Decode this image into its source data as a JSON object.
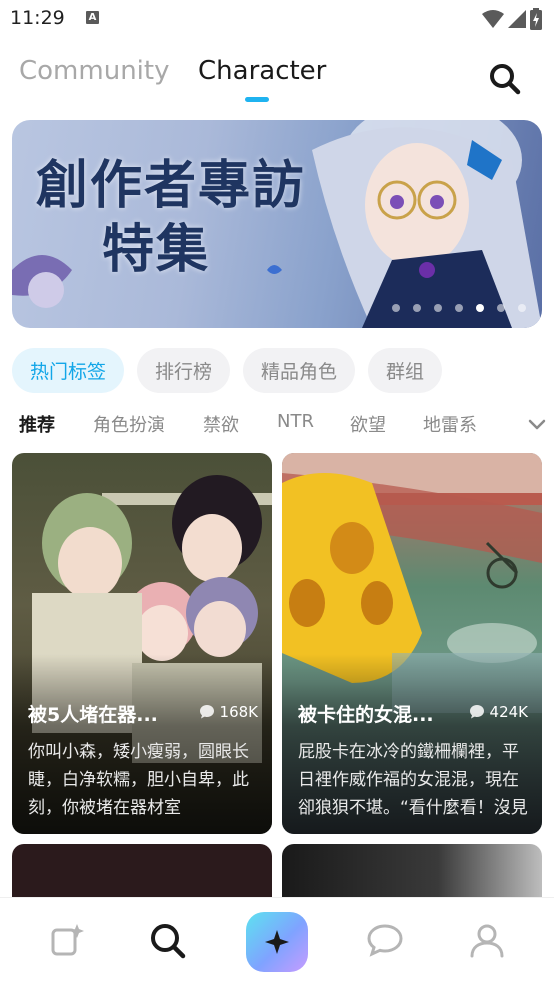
{
  "status": {
    "time": "11:29",
    "indicator_letter": "A"
  },
  "top_tabs": [
    {
      "label": "Community",
      "active": false
    },
    {
      "label": "Character",
      "active": true
    }
  ],
  "banner": {
    "title_line1": "創作者專訪",
    "title_line2": "特集",
    "slide_count": 7,
    "active_slide": 5
  },
  "chips": [
    {
      "label": "热门标签",
      "selected": true
    },
    {
      "label": "排行榜",
      "selected": false
    },
    {
      "label": "精品角色",
      "selected": false
    },
    {
      "label": "群组",
      "selected": false
    }
  ],
  "subtabs": [
    {
      "label": "推荐",
      "active": true
    },
    {
      "label": "角色扮演",
      "active": false
    },
    {
      "label": "禁欲",
      "active": false
    },
    {
      "label": "NTR",
      "active": false
    },
    {
      "label": "欲望",
      "active": false
    },
    {
      "label": "地雷系",
      "active": false
    }
  ],
  "cards": [
    {
      "title": "被5人堵在器...",
      "count": "168K",
      "description": "你叫小森，矮小瘦弱，圆眼长睫，白净软糯，胆小自卑，此刻，你被堵在器材室"
    },
    {
      "title": "被卡住的女混...",
      "count": "424K",
      "description": "屁股卡在冰冷的鐵柵欄裡，平日裡作威作福的女混混，現在卻狼狽不堪。“看什麼看！沒見過有人卡住嗎！”..."
    }
  ],
  "colors": {
    "accent": "#1fb3f0",
    "chip_selected_bg": "#e4f5fd",
    "chip_selected_text": "#12a6e8"
  },
  "icons": {
    "search": "search-icon",
    "create": "create-sparkle-icon",
    "discover": "discover-search-icon",
    "center": "sparkle-icon",
    "chat": "chat-bubble-icon",
    "profile": "profile-icon",
    "chevron": "chevron-down-icon",
    "comment": "comment-bubble-icon"
  }
}
